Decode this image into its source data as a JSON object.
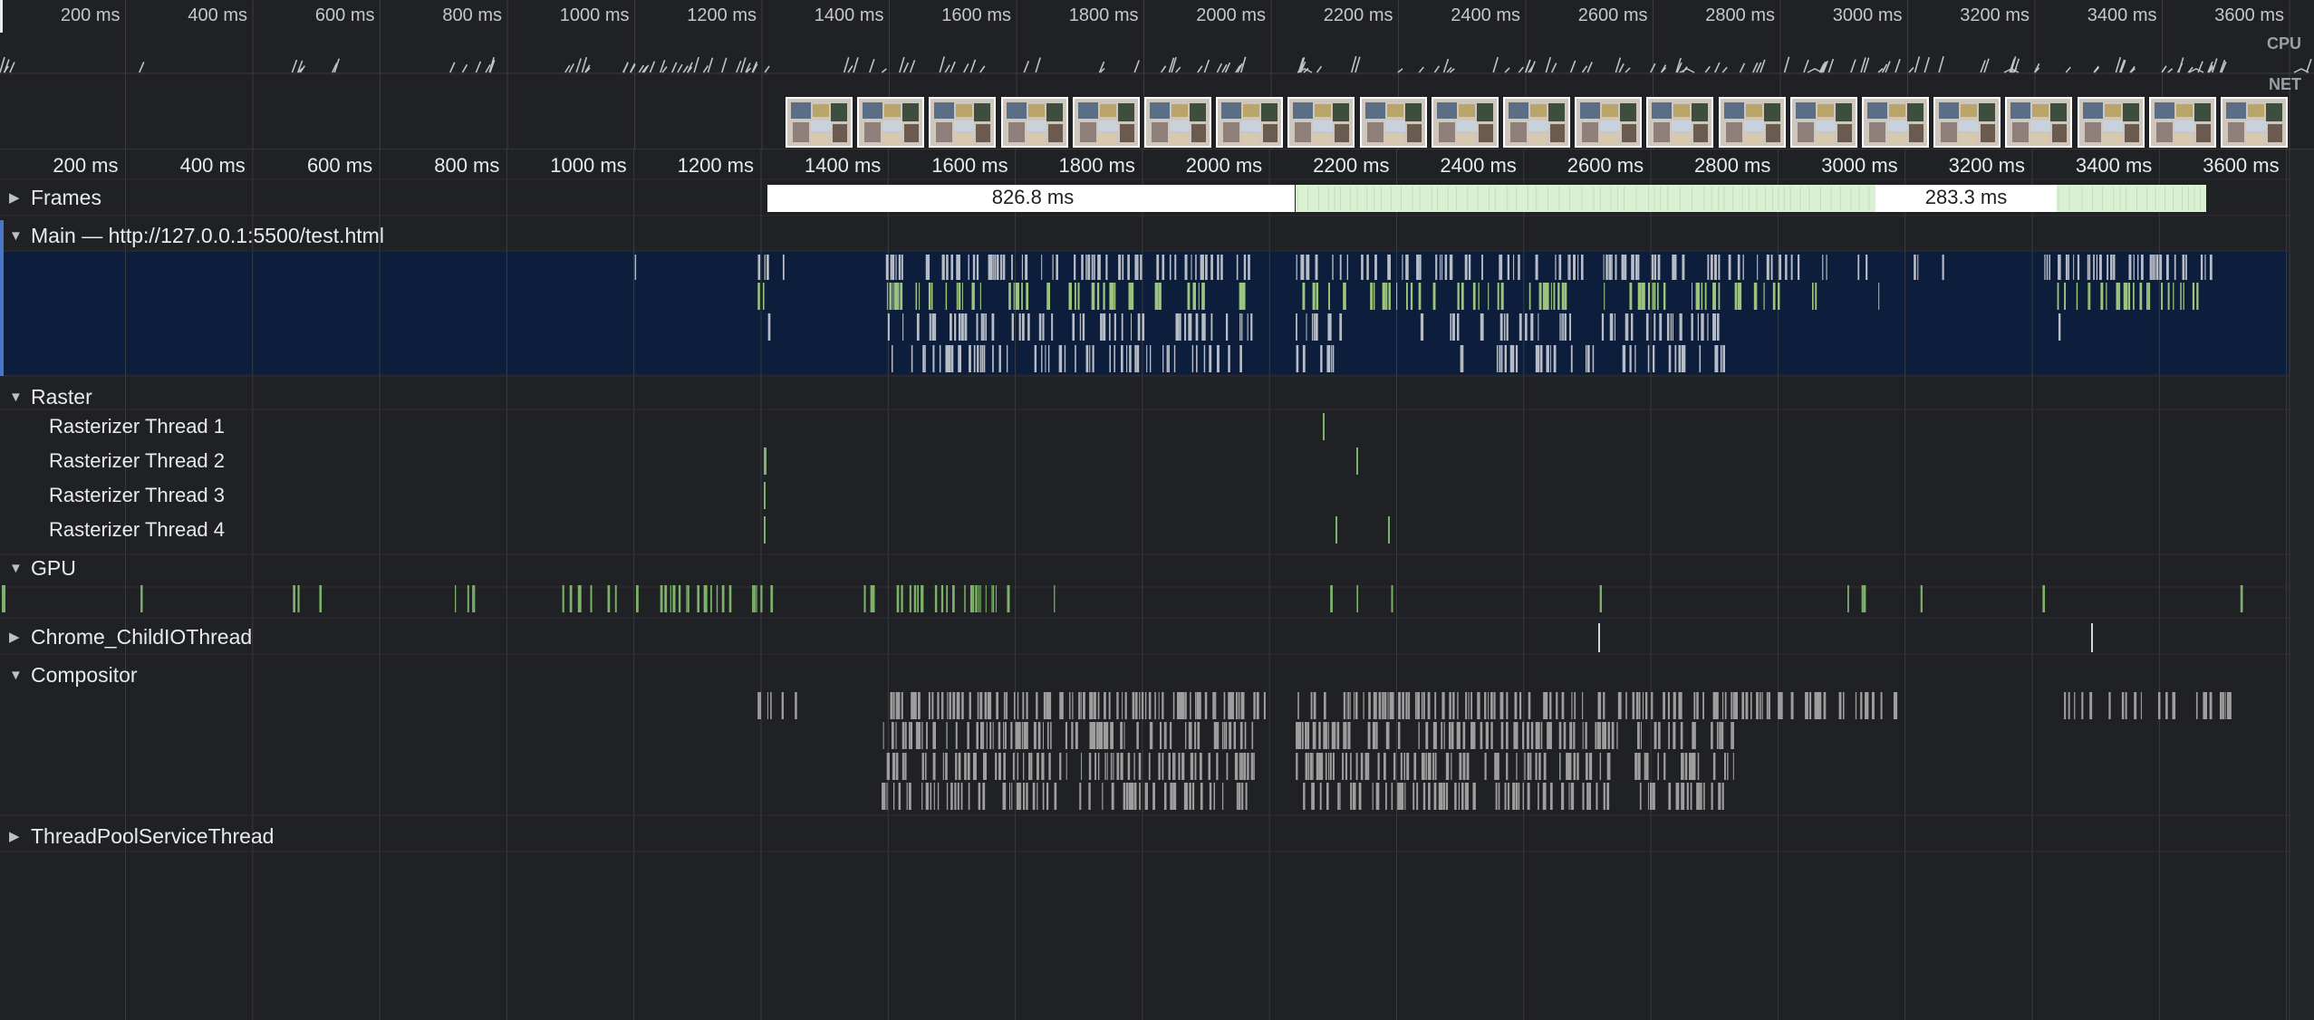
{
  "overview": {
    "ticks": [
      "200 ms",
      "400 ms",
      "600 ms",
      "800 ms",
      "1000 ms",
      "1200 ms",
      "1400 ms",
      "1600 ms",
      "1800 ms",
      "2000 ms",
      "2200 ms",
      "2400 ms",
      "2600 ms",
      "2800 ms",
      "3000 ms",
      "3200 ms",
      "3400 ms",
      "3600 ms"
    ],
    "cpu_label": "CPU",
    "net_label": "NET",
    "screenshot_count": 21
  },
  "timeline": {
    "ticks": [
      "200 ms",
      "400 ms",
      "600 ms",
      "800 ms",
      "1000 ms",
      "1200 ms",
      "1400 ms",
      "1600 ms",
      "1800 ms",
      "2000 ms",
      "2200 ms",
      "2400 ms",
      "2600 ms",
      "2800 ms",
      "3000 ms",
      "3200 ms",
      "3400 ms",
      "3600 ms"
    ]
  },
  "tracks": {
    "frames": {
      "label": "Frames",
      "long_frame_1": "826.8 ms",
      "long_frame_2": "283.3 ms"
    },
    "main": {
      "label": "Main — http://127.0.0.1:5500/test.html"
    },
    "raster": {
      "label": "Raster",
      "threads": [
        "Rasterizer Thread 1",
        "Rasterizer Thread 2",
        "Rasterizer Thread 3",
        "Rasterizer Thread 4"
      ]
    },
    "gpu": {
      "label": "GPU"
    },
    "io": {
      "label": "Chrome_ChildIOThread"
    },
    "compositor": {
      "label": "Compositor"
    },
    "threadpool": {
      "label": "ThreadPoolServiceThread"
    }
  },
  "colors": {
    "background": "#202124",
    "main_selected": "#0c1e3c",
    "frame_idle": "#ffffff",
    "frame_partial": "#d9f0d3",
    "gpu_event": "#7cb26a",
    "compositor_event": "#9e9e9e",
    "main_event": "#b7bcc6",
    "main_event_green": "#9dc47d",
    "selection": "#4a76c8"
  }
}
